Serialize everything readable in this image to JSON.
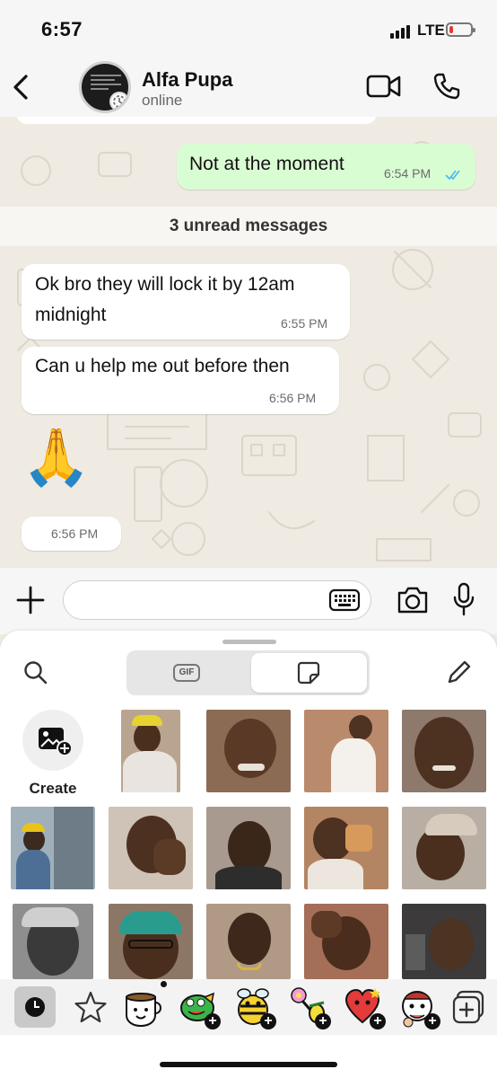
{
  "status_bar": {
    "time": "6:57",
    "network": "LTE",
    "battery_level": 0.2
  },
  "header": {
    "contact_name": "Alfa Pupa",
    "contact_status": "online"
  },
  "messages": [
    {
      "direction": "outgoing",
      "text": "Not at the moment",
      "time": "6:54 PM",
      "read": true
    },
    {
      "direction": "incoming",
      "text_lines": [
        "Ok bro they will lock it by 12am",
        "midnight"
      ],
      "time": "6:55 PM"
    },
    {
      "direction": "incoming",
      "text": "Can u help me out before then",
      "time": "6:56 PM"
    },
    {
      "direction": "incoming",
      "emoji": "🙏",
      "time": "6:56 PM"
    }
  ],
  "unread_divider": "3 unread messages",
  "sticker_panel": {
    "tabs": [
      {
        "label": "GIF",
        "selected": false
      },
      {
        "label": "sticker",
        "selected": true
      }
    ],
    "create_label": "Create",
    "tray_icons": [
      "recent-icon",
      "star-icon",
      "sticker-pack-cup",
      "sticker-pack-turtle",
      "sticker-pack-bee",
      "sticker-pack-flower",
      "sticker-pack-heart",
      "sticker-pack-monkey",
      "add-sticker-pack-icon"
    ]
  },
  "colors": {
    "outgoing_bubble": "#d9fdd3",
    "incoming_bubble": "#ffffff",
    "read_ticks": "#53bdeb",
    "chat_background": "#efeae2"
  }
}
